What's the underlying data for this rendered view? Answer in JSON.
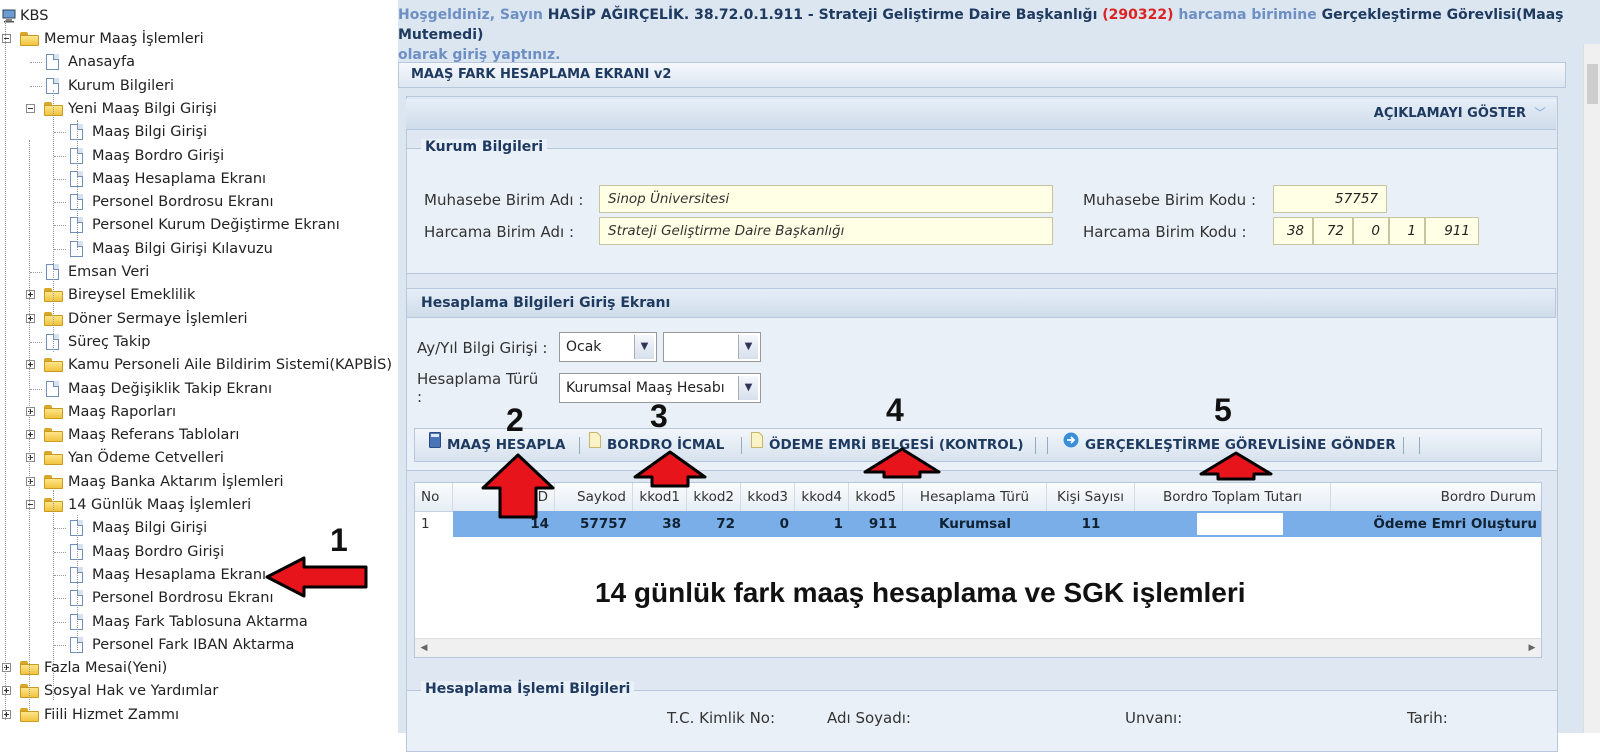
{
  "tree": {
    "root": "KBS",
    "items": [
      {
        "label": "Memur Maaş İşlemleri",
        "type": "folder"
      },
      {
        "label": "Anasayfa",
        "type": "doc"
      },
      {
        "label": "Kurum Bilgileri",
        "type": "doc"
      },
      {
        "label": "Yeni Maaş Bilgi Girişi",
        "type": "folder"
      },
      {
        "label": "Maaş Bilgi Girişi",
        "type": "doc"
      },
      {
        "label": "Maaş Bordro Girişi",
        "type": "doc"
      },
      {
        "label": "Maaş Hesaplama Ekranı",
        "type": "doc"
      },
      {
        "label": "Personel Bordrosu Ekranı",
        "type": "doc"
      },
      {
        "label": "Personel Kurum Değiştirme Ekranı",
        "type": "doc"
      },
      {
        "label": "Maaş Bilgi Girişi Kılavuzu",
        "type": "doc"
      },
      {
        "label": "Emsan Veri",
        "type": "doc"
      },
      {
        "label": "Bireysel Emeklilik",
        "type": "folder"
      },
      {
        "label": "Döner Sermaye İşlemleri",
        "type": "folder"
      },
      {
        "label": "Süreç Takip",
        "type": "doc"
      },
      {
        "label": "Kamu Personeli Aile Bildirim Sistemi(KAPBİS)",
        "type": "folder"
      },
      {
        "label": "Maaş Değişiklik Takip Ekranı",
        "type": "doc"
      },
      {
        "label": "Maaş Raporları",
        "type": "folder"
      },
      {
        "label": "Maaş Referans Tabloları",
        "type": "folder"
      },
      {
        "label": "Yan Ödeme Cetvelleri",
        "type": "folder"
      },
      {
        "label": "Maaş Banka Aktarım İşlemleri",
        "type": "folder"
      },
      {
        "label": "14 Günlük Maaş İşlemleri",
        "type": "folder"
      },
      {
        "label": "Maaş Bilgi Girişi",
        "type": "doc"
      },
      {
        "label": "Maaş Bordro Girişi",
        "type": "doc"
      },
      {
        "label": "Maaş Hesaplama Ekranı",
        "type": "doc"
      },
      {
        "label": "Personel Bordrosu Ekranı",
        "type": "doc"
      },
      {
        "label": "Maaş Fark Tablosuna Aktarma",
        "type": "doc"
      },
      {
        "label": "Personel Fark IBAN Aktarma",
        "type": "doc"
      },
      {
        "label": "Fazla Mesai(Yeni)",
        "type": "folder"
      },
      {
        "label": "Sosyal Hak ve Yardımlar",
        "type": "folder"
      },
      {
        "label": "Fiili Hizmet Zammı",
        "type": "folder"
      }
    ]
  },
  "welcome": {
    "p1": "Hoşgeldiniz, Sayın ",
    "name": "HASİP AĞIRÇELİK. 38.72.0.1.911 - Strateji Geliştirme Daire Başkanlığı ",
    "code": "(290322)",
    "p2": " harcama birimine ",
    "role": "Gerçekleştirme Görevlisi(Maaş Mutemedi)",
    "p3": "olarak giriş yaptınız."
  },
  "page_title": "MAAŞ FARK HESAPLAMA EKRANI v2",
  "show_description": "AÇIKLAMAYI GÖSTER",
  "kurum": {
    "legend": "Kurum Bilgileri",
    "muhasebe_adi_label": "Muhasebe Birim Adı :",
    "muhasebe_adi": "Sinop Üniversitesi",
    "harcama_adi_label": "Harcama Birim Adı :",
    "harcama_adi": "Strateji Geliştirme Daire Başkanlığı",
    "muhasebe_kodu_label": "Muhasebe Birim Kodu :",
    "muhasebe_kodu": "57757",
    "harcama_kodu_label": "Harcama Birim Kodu :",
    "harcama_kodu": [
      "38",
      "72",
      "0",
      "1",
      "911"
    ]
  },
  "hesaplama": {
    "title": "Hesaplama Bilgileri Giriş Ekranı",
    "ayyil_label": "Ay/Yıl Bilgi Girişi :",
    "ay": "Ocak",
    "yil": "",
    "tur_label": "Hesaplama Türü",
    "tur_label_colon": ":",
    "tur": "Kurumsal Maaş Hesabı"
  },
  "toolbar": {
    "maas_hesapla": "MAAŞ HESAPLA",
    "bordro_icmal": "BORDRO İCMAL",
    "odeme_emri": "ÖDEME EMRİ BELGESİ (KONTROL)",
    "gonder": "GERÇEKLEŞTİRME GÖREVLİSİNE GÖNDER"
  },
  "grid": {
    "headers": [
      "No",
      "ID",
      "Saykod",
      "kkod1",
      "kkod2",
      "kkod3",
      "kkod4",
      "kkod5",
      "Hesaplama Türü",
      "Kişi Sayısı",
      "Bordro Toplam Tutarı",
      "Bordro Durum"
    ],
    "row": [
      "1",
      "14",
      "57757",
      "38",
      "72",
      "0",
      "1",
      "911",
      "Kurumsal",
      "11",
      "",
      "Ödeme Emri Oluşturu"
    ]
  },
  "overlay_text": "14 günlük fark maaş hesaplama ve SGK işlemleri",
  "numbers": [
    "1",
    "2",
    "3",
    "4",
    "5"
  ],
  "bottom": {
    "legend": "Hesaplama İşlemi Bilgileri",
    "tc": "T.C. Kimlik No:",
    "adsoyad": "Adı Soyadı:",
    "unvani": "Unvanı:",
    "tarih": "Tarih:"
  },
  "colors": {
    "accent": "#1f3a60",
    "selected_row": "#7aaee8",
    "annotation_red": "#e8141b"
  }
}
